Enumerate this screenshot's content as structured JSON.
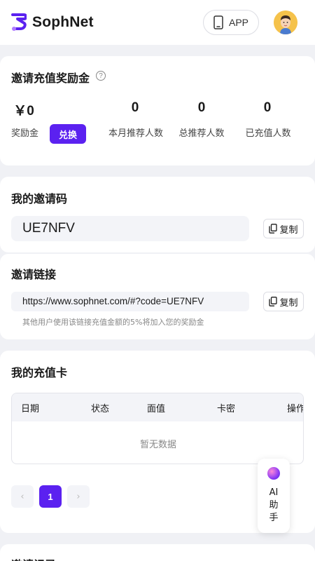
{
  "header": {
    "brand": "SophNet",
    "app_label": "APP"
  },
  "rewards": {
    "title": "邀请充值奖励金",
    "help_glyph": "?",
    "balance_value": "￥0",
    "balance_label": "奖励金",
    "redeem_label": "兑换",
    "month_referrals_value": "0",
    "month_referrals_label": "本月推荐人数",
    "total_referrals_value": "0",
    "total_referrals_label": "总推荐人数",
    "recharged_value": "0",
    "recharged_label": "已充值人数"
  },
  "invite_code": {
    "title": "我的邀请码",
    "code": "UE7NFV",
    "copy_label": "复制"
  },
  "invite_link": {
    "title": "邀请链接",
    "url": "https://www.sophnet.com/#?code=UE7NFV",
    "copy_label": "复制",
    "hint": "其他用户使用该链接充值金额的5%将加入您的奖励金"
  },
  "recharge_cards": {
    "title": "我的充值卡",
    "columns": [
      "日期",
      "状态",
      "面值",
      "卡密",
      "操作"
    ],
    "empty_text": "暂无数据",
    "pagination": {
      "prev": "‹",
      "current": "1",
      "next": "›"
    }
  },
  "invite_records": {
    "title": "邀请记录"
  },
  "ai_assistant": {
    "line1": "AI",
    "line2": "助",
    "line3": "手"
  },
  "colors": {
    "accent": "#5b21f0",
    "background": "#f0f1f5",
    "card": "#ffffff"
  }
}
